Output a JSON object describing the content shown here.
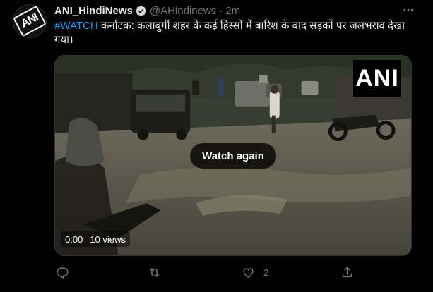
{
  "tweet": {
    "display_name": "ANI_HindiNews",
    "handle": "@AHindinews",
    "separator": "·",
    "time": "2m",
    "hashtag": "#WATCH",
    "body": " कर्नाटक: कलाबुर्गी शहर के कई हिस्सों में बारिश के बाद सड़कों पर जलभराव देखा गया।",
    "avatar_logo_text": "ANI"
  },
  "media": {
    "watermark": "ANI",
    "watch_again_label": "Watch again",
    "duration": "0:00",
    "views": "10 views"
  },
  "actions": {
    "reply_count": "",
    "retweet_count": "",
    "like_count": "2",
    "share_count": ""
  },
  "icons": {
    "verified": "verified-badge-icon",
    "more": "more-icon",
    "reply": "reply-icon",
    "retweet": "retweet-icon",
    "like": "like-icon",
    "share": "share-icon"
  },
  "colors": {
    "background": "#000000",
    "accent": "#1d9bf0",
    "muted": "#71767b",
    "text": "#e7e9ea"
  }
}
